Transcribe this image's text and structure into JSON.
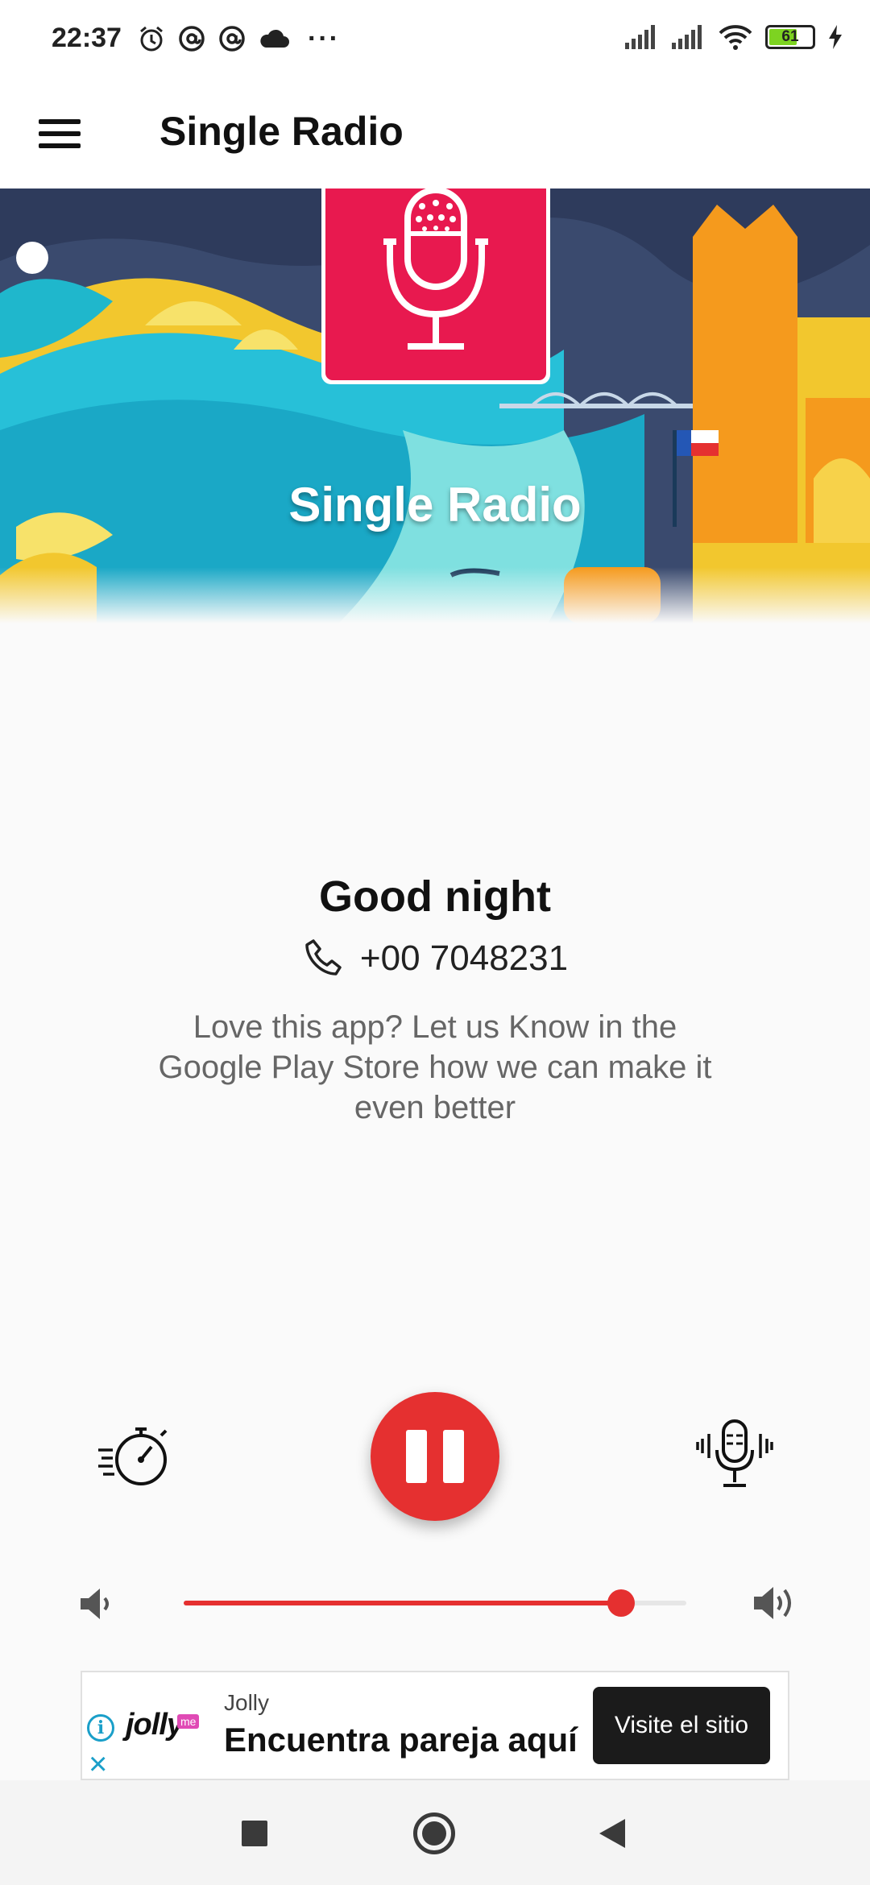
{
  "status_bar": {
    "time": "22:37",
    "battery_level": "61",
    "icons": [
      "alarm-icon",
      "at-sign-icon",
      "at-sign-icon",
      "cloud-icon",
      "more-dots-icon",
      "signal-icon",
      "signal-icon",
      "wifi-icon",
      "battery-icon",
      "charging-icon"
    ]
  },
  "app_bar": {
    "title": "Single Radio",
    "menu_icon": "hamburger-menu-icon"
  },
  "banner": {
    "station_name": "Single Radio",
    "logo_icon": "microphone-icon",
    "logo_color": "#e8194f"
  },
  "info": {
    "greeting": "Good night",
    "phone": "+00 7048231",
    "phone_icon": "phone-icon",
    "message": "Love this app? Let us Know in the Google Play Store how we can make it even better"
  },
  "controls": {
    "timer_icon": "stopwatch-icon",
    "play_state": "playing",
    "play_icon": "pause-icon",
    "mic_icon": "podcast-mic-icon",
    "accent_color": "#e53030"
  },
  "volume": {
    "level": 0.87,
    "low_icon": "volume-low-icon",
    "high_icon": "volume-high-icon"
  },
  "ad": {
    "logo_text": "jolly",
    "logo_badge": "me",
    "sponsor": "Jolly",
    "headline": "Encuentra pareja aquí",
    "cta": "Visite el sitio"
  },
  "nav_bar": {
    "buttons": [
      "recents-square-icon",
      "home-circle-icon",
      "back-triangle-icon"
    ]
  }
}
